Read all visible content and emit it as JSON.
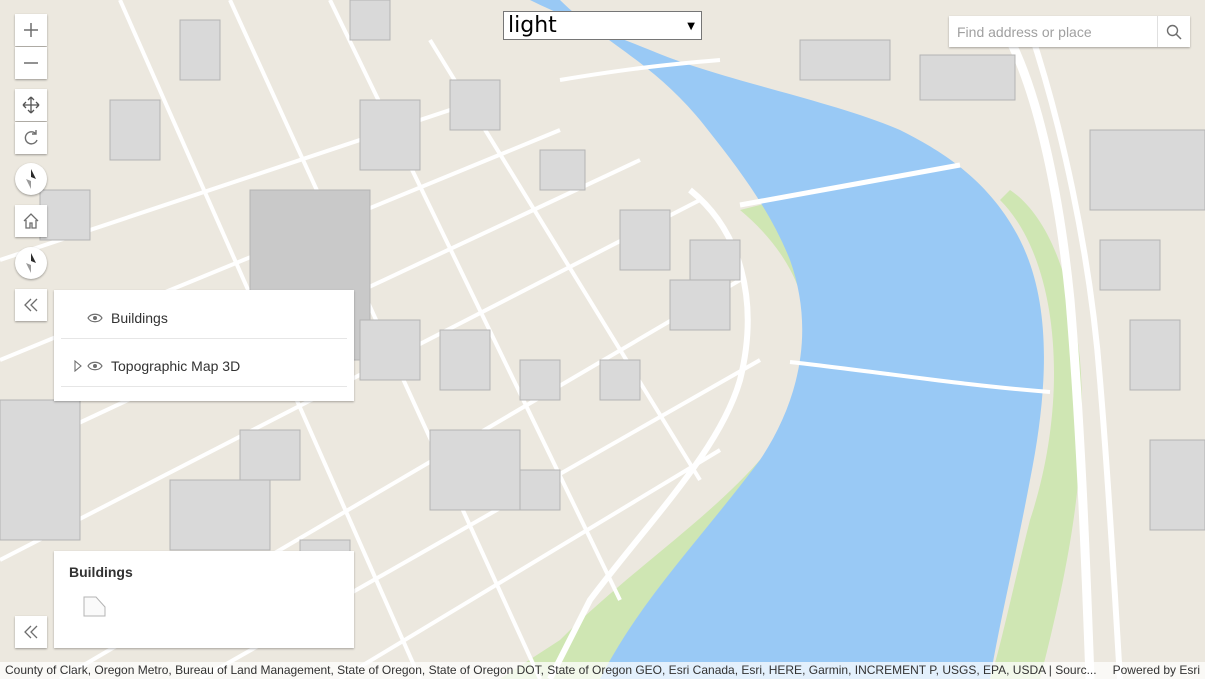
{
  "map": {
    "colors": {
      "ground": "#ece8df",
      "water": "#99c9f5",
      "park": "#cfe6b3",
      "road": "#ffffff",
      "building": "#d8d8d8"
    }
  },
  "nav_controls": {
    "zoom_in_icon": "plus-icon",
    "zoom_out_icon": "minus-icon",
    "pan_icon": "move-arrows-icon",
    "rotate_icon": "rotate-icon",
    "compass_icon": "compass-needle-icon",
    "home_icon": "home-icon",
    "compass2_icon": "compass-needle-icon",
    "collapse_layers_icon": "double-chevron-left-icon",
    "collapse_legend_icon": "double-chevron-left-icon"
  },
  "basemap_select": {
    "value": "light",
    "caret": "▼"
  },
  "search": {
    "placeholder": "Find address or place",
    "icon": "search-icon"
  },
  "layer_list": {
    "items": [
      {
        "label": "Buildings",
        "visible_icon": "eye-icon"
      },
      {
        "label": "Topographic Map 3D",
        "visible_icon": "eye-icon",
        "expand_icon": "triangle-right-icon"
      }
    ]
  },
  "legend": {
    "title": "Buildings",
    "symbol": "building-polygon-icon"
  },
  "attribution": {
    "sources": "County of Clark, Oregon Metro, Bureau of Land Management, State of Oregon, State of Oregon DOT, State of Oregon GEO, Esri Canada, Esri, HERE, Garmin, INCREMENT P, USGS, EPA, USDA | Sourc...",
    "powered_by": "Powered by Esri"
  }
}
